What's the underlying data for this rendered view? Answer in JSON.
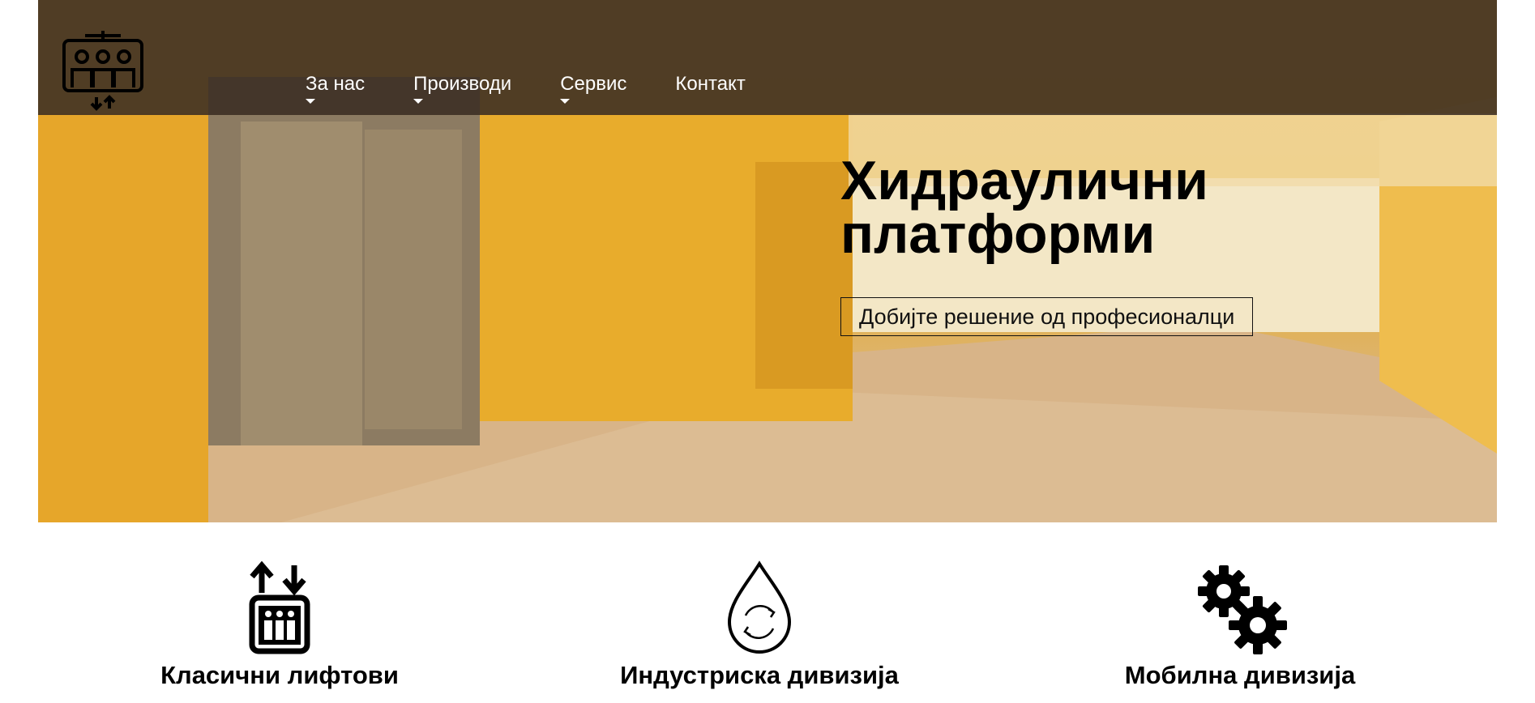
{
  "header": {
    "logo_icon": "elevator-people-logo-icon",
    "nav": [
      {
        "label": "За нас",
        "has_dropdown": true
      },
      {
        "label": "Производи",
        "has_dropdown": true
      },
      {
        "label": "Сервис",
        "has_dropdown": true
      },
      {
        "label": "Контакт",
        "has_dropdown": false
      }
    ]
  },
  "hero": {
    "title_line1": "Хидраулични",
    "title_line2": "платформи",
    "cta_label": "Добијте решение од професионалци",
    "background": "elevator-lobby-photo"
  },
  "features": [
    {
      "icon": "elevator-arrows-icon",
      "title": "Класични лифтови"
    },
    {
      "icon": "water-drop-cycle-icon",
      "title": "Индустриска дивизија"
    },
    {
      "icon": "gears-icon",
      "title": "Мобилна дивизија"
    }
  ],
  "colors": {
    "accent_yellow": "#e6ad2b",
    "topbar": "#3a2c22",
    "text": "#000000"
  }
}
